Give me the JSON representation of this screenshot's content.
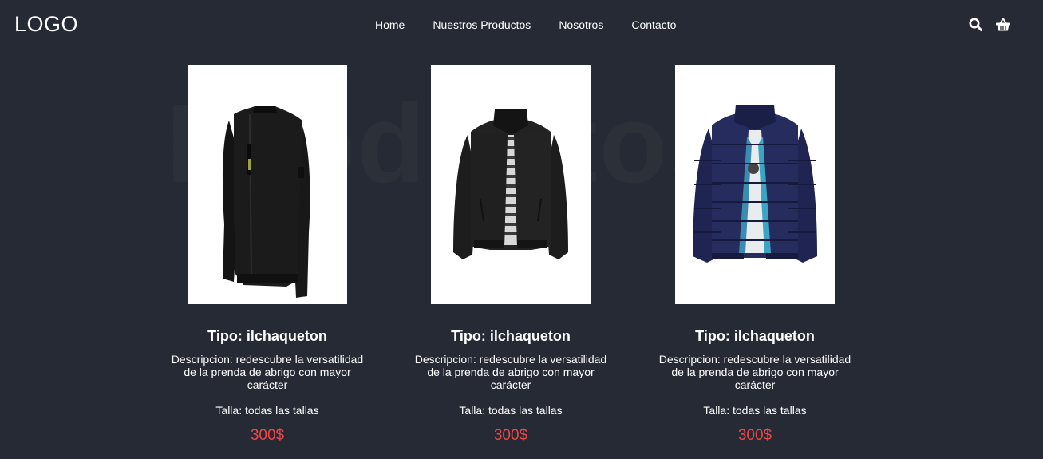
{
  "header": {
    "logo": "LOGO",
    "nav": [
      "Home",
      "Nuestros Productos",
      "Nosotros",
      "Contacto"
    ],
    "icons": [
      "search-icon",
      "basket-icon"
    ]
  },
  "watermark": "Productos",
  "products": [
    {
      "image": "black-bomber-jacket",
      "title": "Tipo: ilchaqueton",
      "description": "Descripcion: redescubre la versatilidad de la prenda de abrigo con mayor carácter",
      "size": "Talla: todas las tallas",
      "price": "300$"
    },
    {
      "image": "black-harrington-jacket",
      "title": "Tipo: ilchaqueton",
      "description": "Descripcion: redescubre la versatilidad de la prenda de abrigo con mayor carácter",
      "size": "Talla: todas las tallas",
      "price": "300$"
    },
    {
      "image": "navy-puffer-jacket",
      "title": "Tipo: ilchaqueton",
      "description": "Descripcion: redescubre la versatilidad de la prenda de abrigo con mayor carácter",
      "size": "Talla: todas las tallas",
      "price": "300$"
    }
  ],
  "colors": {
    "background": "#262a34",
    "price": "#ef4747",
    "card": "#ffffff"
  }
}
